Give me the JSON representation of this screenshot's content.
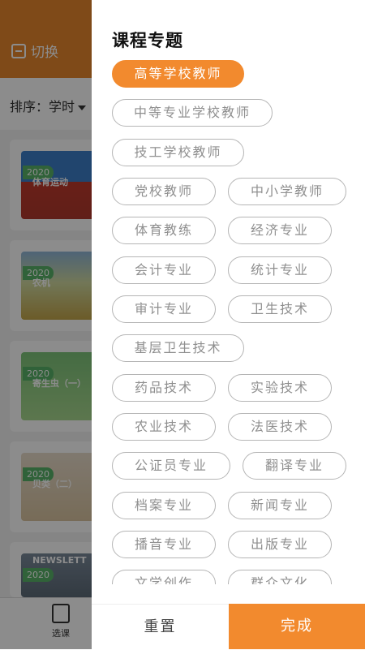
{
  "background": {
    "switch_label": "切换",
    "sort_label": "排序：学时",
    "cards": [
      {
        "year": "2020",
        "title": "体育运动"
      },
      {
        "year": "2020",
        "title": "农机"
      },
      {
        "year": "2020",
        "title": "寄生虫（一）"
      },
      {
        "year": "2020",
        "title": "贝类（二）"
      },
      {
        "year": "2020",
        "title": "NEWSLETT"
      }
    ],
    "tab_label": "选课"
  },
  "drawer": {
    "title": "课程专题",
    "chips": [
      {
        "label": "高等学校教师",
        "selected": true
      },
      {
        "label": "中等专业学校教师",
        "selected": false
      },
      {
        "label": "技工学校教师",
        "selected": false
      },
      {
        "label": "党校教师",
        "selected": false
      },
      {
        "label": "中小学教师",
        "selected": false
      },
      {
        "label": "体育教练",
        "selected": false
      },
      {
        "label": "经济专业",
        "selected": false
      },
      {
        "label": "会计专业",
        "selected": false
      },
      {
        "label": "统计专业",
        "selected": false
      },
      {
        "label": "审计专业",
        "selected": false
      },
      {
        "label": "卫生技术",
        "selected": false
      },
      {
        "label": "基层卫生技术",
        "selected": false
      },
      {
        "label": "药品技术",
        "selected": false
      },
      {
        "label": "实验技术",
        "selected": false
      },
      {
        "label": "农业技术",
        "selected": false
      },
      {
        "label": "法医技术",
        "selected": false
      },
      {
        "label": "公证员专业",
        "selected": false
      },
      {
        "label": "翻译专业",
        "selected": false
      },
      {
        "label": "档案专业",
        "selected": false
      },
      {
        "label": "新闻专业",
        "selected": false
      },
      {
        "label": "播音专业",
        "selected": false
      },
      {
        "label": "出版专业",
        "selected": false
      },
      {
        "label": "文学创作",
        "selected": false
      },
      {
        "label": "群众文化",
        "selected": false
      }
    ],
    "reset_label": "重置",
    "done_label": "完成"
  },
  "colors": {
    "accent": "#f28a2e",
    "chip_border": "#b5b5b5",
    "chip_text": "#8f8f8f",
    "header_bg": "#e8872c"
  }
}
